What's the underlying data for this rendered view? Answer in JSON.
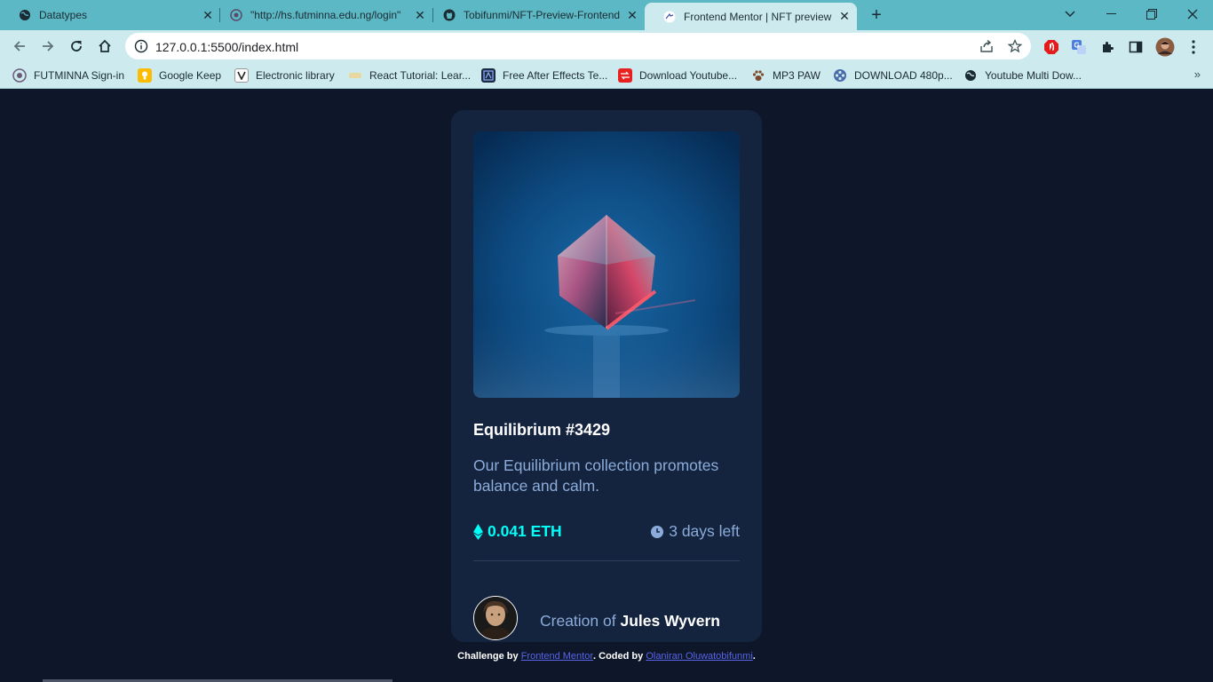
{
  "browser": {
    "tabs": [
      {
        "title": "Datatypes",
        "icon": "globe-icon"
      },
      {
        "title": "\"http://hs.futminna.edu.ng/login\"",
        "icon": "futminna-icon"
      },
      {
        "title": "Tobifunmi/NFT-Preview-Frontend",
        "icon": "github-icon"
      },
      {
        "title": "Frontend Mentor | NFT preview c",
        "icon": "frontend-mentor-icon",
        "active": true
      }
    ],
    "new_tab": "+",
    "url": "127.0.0.1:5500/index.html",
    "bookmarks": [
      {
        "label": "FUTMINNA Sign-in",
        "icon": "futminna-icon"
      },
      {
        "label": "Google Keep",
        "icon": "google-keep-icon"
      },
      {
        "label": "Electronic library",
        "icon": "library-icon"
      },
      {
        "label": "React Tutorial: Lear...",
        "icon": "react-icon"
      },
      {
        "label": "Free After Effects Te...",
        "icon": "after-effects-icon"
      },
      {
        "label": "Download Youtube...",
        "icon": "youtube-download-icon"
      },
      {
        "label": "MP3 PAW",
        "icon": "paw-icon"
      },
      {
        "label": "DOWNLOAD 480p...",
        "icon": "film-reel-icon"
      },
      {
        "label": "Youtube Multi Dow...",
        "icon": "globe-icon"
      }
    ],
    "bookmarks_more": "»"
  },
  "card": {
    "title": "Equilibrium #3429",
    "description": "Our Equilibrium collection promotes balance and calm.",
    "price": "0.041 ETH",
    "time_left": "3 days left",
    "creator_prefix": "Creation of",
    "creator_name": "Jules Wyvern"
  },
  "attribution": {
    "prefix": "Challenge by",
    "link1": "Frontend Mentor",
    "middle": ". Coded by",
    "link2": "Olaniran Oluwatobifunmi",
    "suffix": "."
  },
  "colors": {
    "page_bg": "#0d1729",
    "card_bg": "#15243e",
    "cyan": "#00fff8",
    "soft_blue": "#8bacda",
    "chrome_tab_bar": "#5cb8c4",
    "chrome_toolbar": "#cdebef"
  }
}
